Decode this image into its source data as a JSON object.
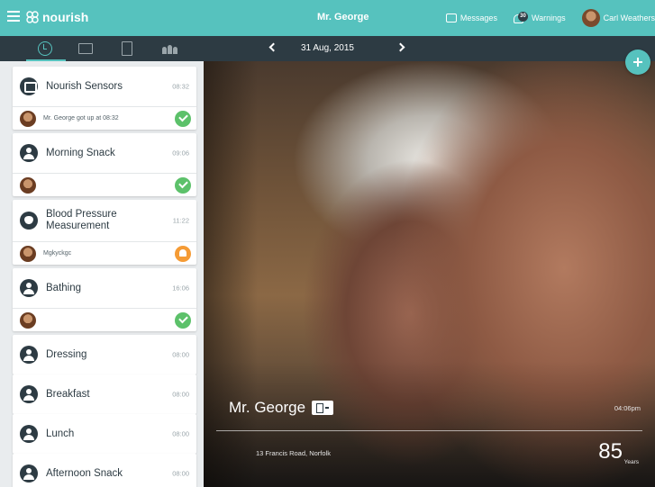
{
  "app": {
    "brand": "nourish",
    "resident_title": "Mr. George"
  },
  "topbar": {
    "messages_label": "Messages",
    "warnings_label": "Warnings",
    "warnings_count": "30",
    "user_name": "Carl Weathers"
  },
  "date_nav": {
    "date": "31 Aug, 2015"
  },
  "timeline": [
    {
      "title": "Nourish Sensors",
      "time": "08:32",
      "note": "Mr. George got up at 08:32",
      "status": "ok"
    },
    {
      "title": "Morning Snack",
      "time": "09:06",
      "note": "",
      "status": "ok"
    },
    {
      "title": "Blood Pressure Measurement",
      "time": "11:22",
      "note": "Mgkyckgc",
      "status": "warn"
    },
    {
      "title": "Bathing",
      "time": "16:06",
      "note": "",
      "status": "ok"
    },
    {
      "title": "Dressing",
      "time": "08:00"
    },
    {
      "title": "Breakfast",
      "time": "08:00"
    },
    {
      "title": "Lunch",
      "time": "08:00"
    },
    {
      "title": "Afternoon Snack",
      "time": "08:00"
    }
  ],
  "profile": {
    "name": "Mr. George",
    "time": "04:06pm",
    "address": "13 Francis Road, Norfolk",
    "age": "85",
    "age_unit": "Years"
  },
  "colors": {
    "accent": "#56c2be",
    "dark": "#2d3b43",
    "ok": "#5cc16a",
    "warn": "#f59b35"
  }
}
